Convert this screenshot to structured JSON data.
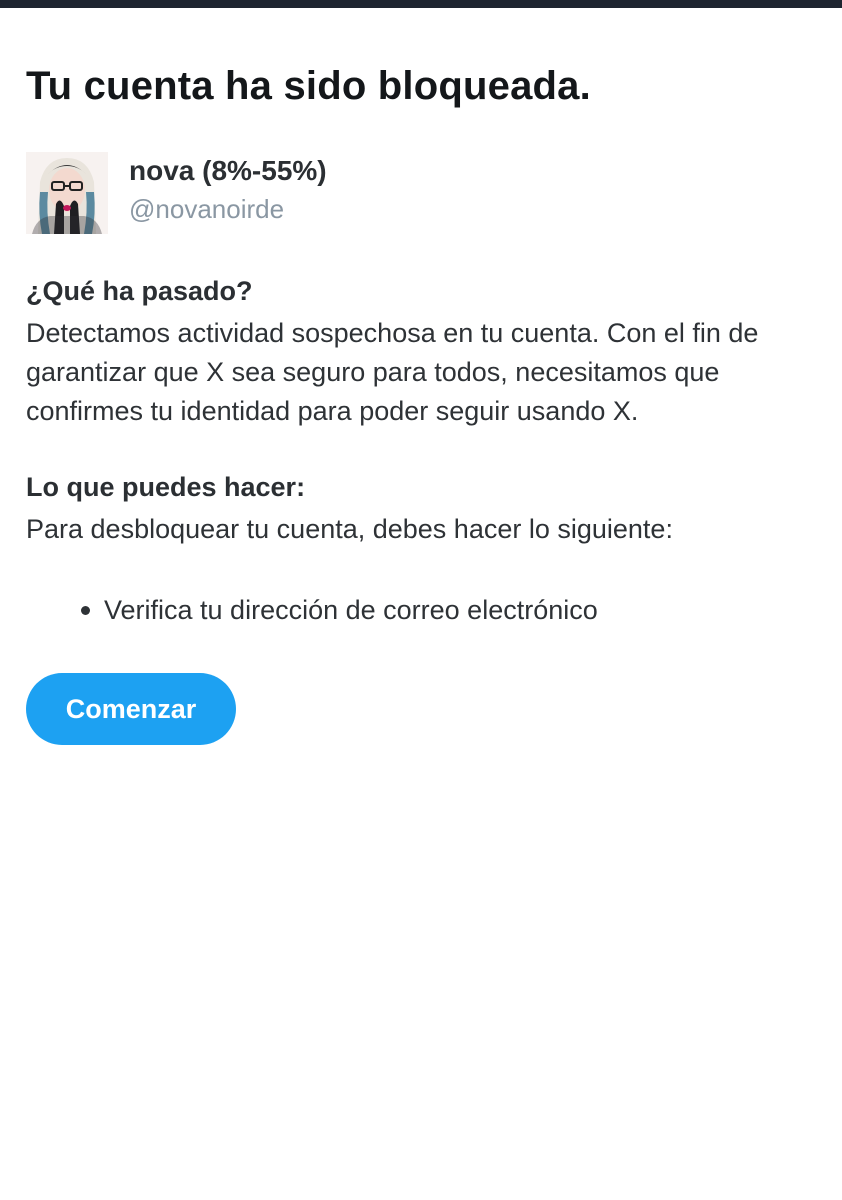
{
  "header": {
    "title": "Tu cuenta ha sido bloqueada."
  },
  "account": {
    "display_name": "nova (8%-55%)",
    "handle": "@novanoirde",
    "avatar_icon": "user-avatar-photo"
  },
  "what_happened": {
    "heading": "¿Qué ha pasado?",
    "body": "Detectamos actividad sospechosa en tu cuenta. Con el fin de garantizar que X sea seguro para todos, necesitamos que confirmes tu identidad para poder seguir usando X."
  },
  "what_you_can_do": {
    "heading": "Lo que puedes hacer:",
    "body": "Para desbloquear tu cuenta, debes hacer lo siguiente:",
    "steps": [
      "Verifica tu dirección de correo electrónico"
    ]
  },
  "actions": {
    "start_label": "Comenzar"
  },
  "colors": {
    "accent": "#1da1f2",
    "text_primary": "#14171a",
    "text_secondary": "#8a97a3",
    "top_bar": "#1e2530"
  }
}
